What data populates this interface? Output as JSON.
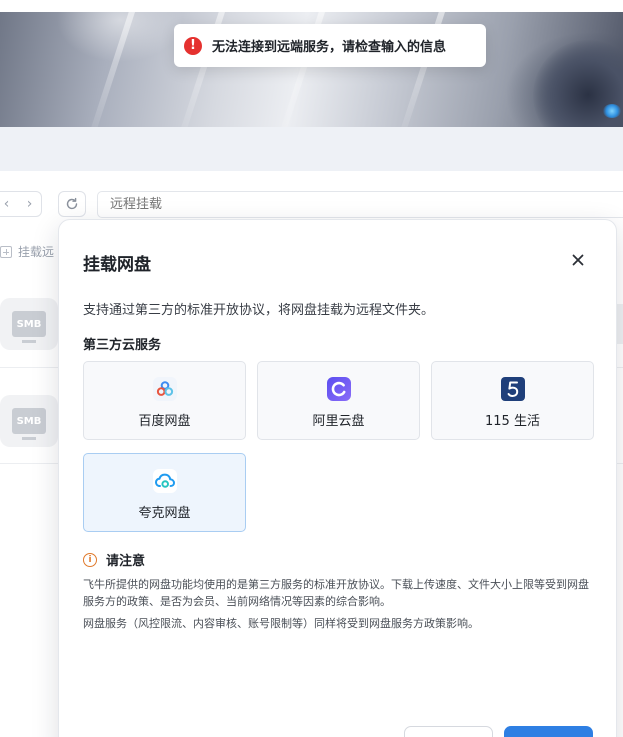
{
  "toast": {
    "message": "无法连接到远端服务，请检查输入的信息",
    "icon": "error-icon",
    "color": "#e5312f"
  },
  "toolbar": {
    "path_placeholder": "远程挂载",
    "mount_label": "挂载远"
  },
  "list": {
    "items": [
      {
        "icon": "smb-icon",
        "label": "SMB"
      },
      {
        "icon": "smb-icon",
        "label": "SMB"
      }
    ]
  },
  "dialog": {
    "title": "挂载网盘",
    "description": "支持通过第三方的标准开放协议，将网盘挂载为远程文件夹。",
    "section_title": "第三方云服务",
    "providers": [
      {
        "label": "百度网盘",
        "icon": "baidu-netdisk-icon",
        "selected": false
      },
      {
        "label": "阿里云盘",
        "icon": "aliyun-drive-icon",
        "selected": false
      },
      {
        "label": "115 生活",
        "icon": "115-life-icon",
        "selected": false
      },
      {
        "label": "夸克网盘",
        "icon": "quark-drive-icon",
        "selected": true
      }
    ],
    "notice": {
      "title": "请注意",
      "paragraph_1": "飞牛所提供的网盘功能均使用的是第三方服务的标准开放协议。下载上传速度、文件大小上限等受到网盘服务方的政策、是否为会员、当前网络情况等因素的综合影响。",
      "paragraph_2": "网盘服务（风控限流、内容审核、账号限制等）同样将受到网盘服务方政策影响。"
    },
    "accent_color": "#2e7fe3",
    "warning_color": "#e07a2c"
  }
}
